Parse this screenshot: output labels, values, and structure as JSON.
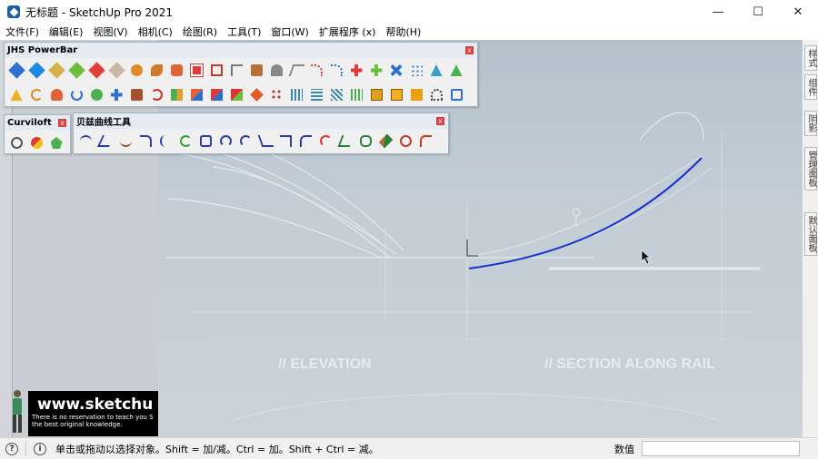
{
  "window": {
    "title": "无标题 - SketchUp Pro 2021",
    "minimize": "—",
    "maximize": "☐",
    "close": "✕"
  },
  "menu": [
    "文件(F)",
    "编辑(E)",
    "视图(V)",
    "相机(C)",
    "绘图(R)",
    "工具(T)",
    "窗口(W)",
    "扩展程序 (x)",
    "帮助(H)"
  ],
  "toolbars": {
    "powerbar": {
      "title": "JHS PowerBar",
      "close": "x"
    },
    "curviloft": {
      "title": "Curviloft",
      "close": "x"
    },
    "bezier": {
      "title": "贝兹曲线工具",
      "close": "x"
    }
  },
  "viewport": {
    "label_elevation": "// ELEVATION",
    "label_section": "// SECTION ALONG RAIL",
    "curve_color": "#1432c8"
  },
  "tray_tabs": [
    "样式",
    "组件",
    "阴影",
    "管理面板",
    "默认面板"
  ],
  "watermark": {
    "url": "www.sketchu",
    "line1": "There is no reservation to teach you S",
    "line2": "the best original knowledge."
  },
  "status": {
    "help_icon": "?",
    "info_icon": "i",
    "message": "单击或拖动以选择对象。Shift = 加/减。Ctrl = 加。Shift + Ctrl = 减。",
    "measure_label": "数值",
    "measure_value": ""
  }
}
